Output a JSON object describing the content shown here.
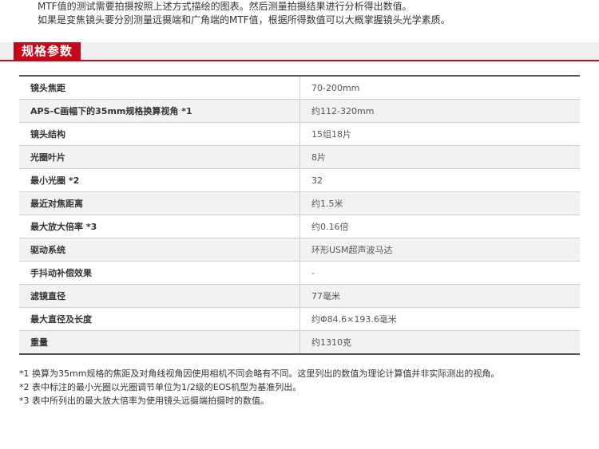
{
  "intro": {
    "line1": "MTF值的测试需要拍摄按照上述方式描绘的图表。然后测量拍摄结果进行分析得出数值。",
    "line2": "如果是变焦镜头要分别测量远摄端和广角端的MTF值，根据所得数值可以大概掌握镜头光学素质。"
  },
  "section": {
    "title": "规格参数"
  },
  "specs": [
    {
      "label": "镜头焦距",
      "value": "70-200mm"
    },
    {
      "label": "APS-C画幅下的35mm规格换算视角 *1",
      "value": "约112-320mm"
    },
    {
      "label": "镜头结构",
      "value": "15组18片"
    },
    {
      "label": "光圈叶片",
      "value": "8片"
    },
    {
      "label": "最小光圈 *2",
      "value": "32"
    },
    {
      "label": "最近对焦距离",
      "value": "约1.5米"
    },
    {
      "label": "最大放大倍率 *3",
      "value": "约0.16倍"
    },
    {
      "label": "驱动系统",
      "value": "环形USM超声波马达"
    },
    {
      "label": "手抖动补偿效果",
      "value": "-"
    },
    {
      "label": "滤镜直径",
      "value": "77毫米"
    },
    {
      "label": "最大直径及长度",
      "value": "约Φ84.6×193.6毫米"
    },
    {
      "label": "重量",
      "value": "约1310克"
    }
  ],
  "notes": [
    "*1 换算为35mm规格的焦距及对角线视角因使用相机不同会略有不同。这里列出的数值为理论计算值并非实际测出的视角。",
    "*2 表中标注的最小光圈以光圈调节单位为1/2级的EOS机型为基准列出。",
    "*3 表中所列出的最大放大倍率为使用镜头远摄端拍摄时的数值。"
  ]
}
